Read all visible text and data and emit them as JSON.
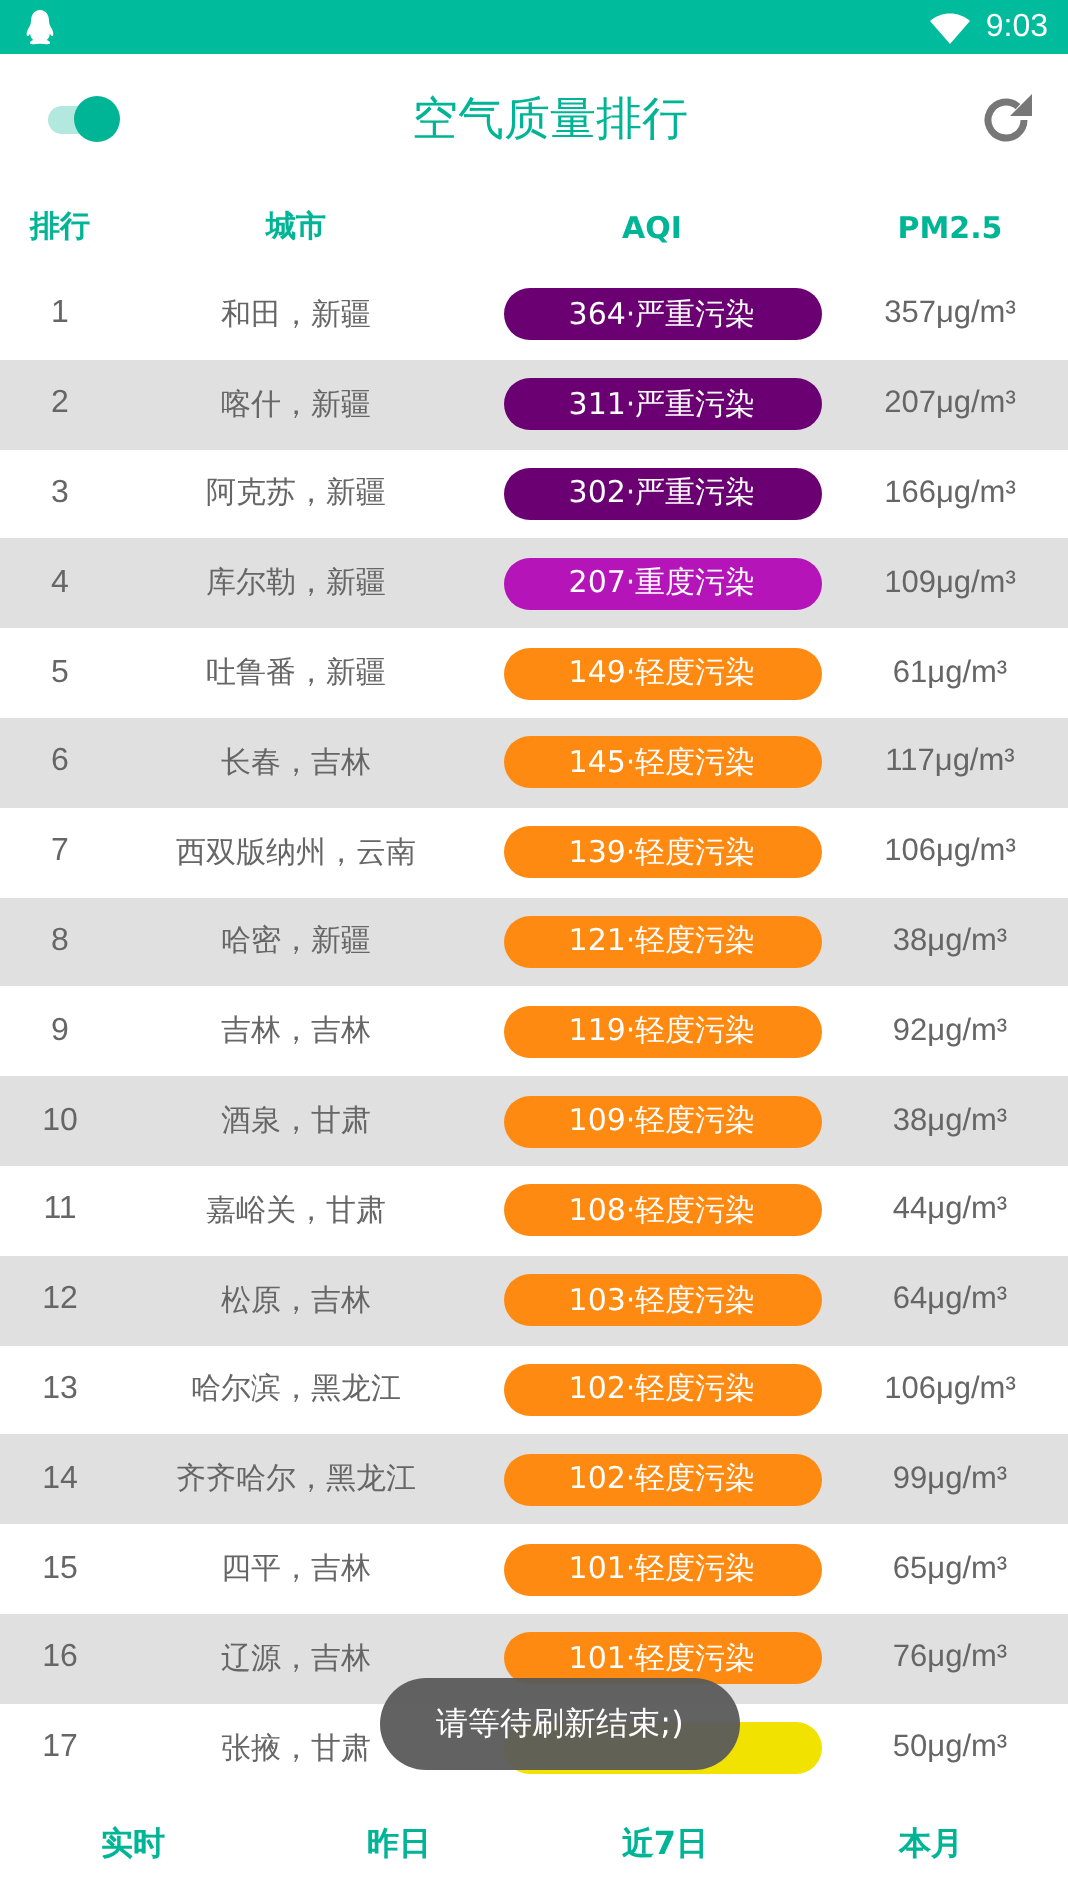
{
  "status_bar": {
    "time": "9:03"
  },
  "header": {
    "toggle": {
      "on": true
    },
    "title": "空气质量排行"
  },
  "table": {
    "columns": [
      "排行",
      "城市",
      "AQI",
      "PM2.5"
    ],
    "rows": [
      {
        "rank": "1",
        "city": "和田，新疆",
        "aqi": "364·严重污染",
        "color": "#6b0073",
        "pm25": "357μg/m³"
      },
      {
        "rank": "2",
        "city": "喀什，新疆",
        "aqi": "311·严重污染",
        "color": "#6b0073",
        "pm25": "207μg/m³"
      },
      {
        "rank": "3",
        "city": "阿克苏，新疆",
        "aqi": "302·严重污染",
        "color": "#6b0073",
        "pm25": "166μg/m³"
      },
      {
        "rank": "4",
        "city": "库尔勒，新疆",
        "aqi": "207·重度污染",
        "color": "#b414b8",
        "pm25": "109μg/m³"
      },
      {
        "rank": "5",
        "city": "吐鲁番，新疆",
        "aqi": "149·轻度污染",
        "color": "#ff8a12",
        "pm25": "61μg/m³"
      },
      {
        "rank": "6",
        "city": "长春，吉林",
        "aqi": "145·轻度污染",
        "color": "#ff8a12",
        "pm25": "117μg/m³"
      },
      {
        "rank": "7",
        "city": "西双版纳州，云南",
        "aqi": "139·轻度污染",
        "color": "#ff8a12",
        "pm25": "106μg/m³"
      },
      {
        "rank": "8",
        "city": "哈密，新疆",
        "aqi": "121·轻度污染",
        "color": "#ff8a12",
        "pm25": "38μg/m³"
      },
      {
        "rank": "9",
        "city": "吉林，吉林",
        "aqi": "119·轻度污染",
        "color": "#ff8a12",
        "pm25": "92μg/m³"
      },
      {
        "rank": "10",
        "city": "酒泉，甘肃",
        "aqi": "109·轻度污染",
        "color": "#ff8a12",
        "pm25": "38μg/m³"
      },
      {
        "rank": "11",
        "city": "嘉峪关，甘肃",
        "aqi": "108·轻度污染",
        "color": "#ff8a12",
        "pm25": "44μg/m³"
      },
      {
        "rank": "12",
        "city": "松原，吉林",
        "aqi": "103·轻度污染",
        "color": "#ff8a12",
        "pm25": "64μg/m³"
      },
      {
        "rank": "13",
        "city": "哈尔滨，黑龙江",
        "aqi": "102·轻度污染",
        "color": "#ff8a12",
        "pm25": "106μg/m³"
      },
      {
        "rank": "14",
        "city": "齐齐哈尔，黑龙江",
        "aqi": "102·轻度污染",
        "color": "#ff8a12",
        "pm25": "99μg/m³"
      },
      {
        "rank": "15",
        "city": "四平，吉林",
        "aqi": "101·轻度污染",
        "color": "#ff8a12",
        "pm25": "65μg/m³"
      },
      {
        "rank": "16",
        "city": "辽源，吉林",
        "aqi": "101·轻度污染",
        "color": "#ff8a12",
        "pm25": "76μg/m³"
      },
      {
        "rank": "17",
        "city": "张掖，甘肃",
        "color": "#f2e200",
        "pm25": "50μg/m³"
      }
    ]
  },
  "toast": "请等待刷新结束;)",
  "bottom_tabs": [
    {
      "label": "实时",
      "selected": true
    },
    {
      "label": "昨日",
      "selected": true
    },
    {
      "label": "近7日",
      "selected": true
    },
    {
      "label": "本月",
      "selected": true
    }
  ]
}
